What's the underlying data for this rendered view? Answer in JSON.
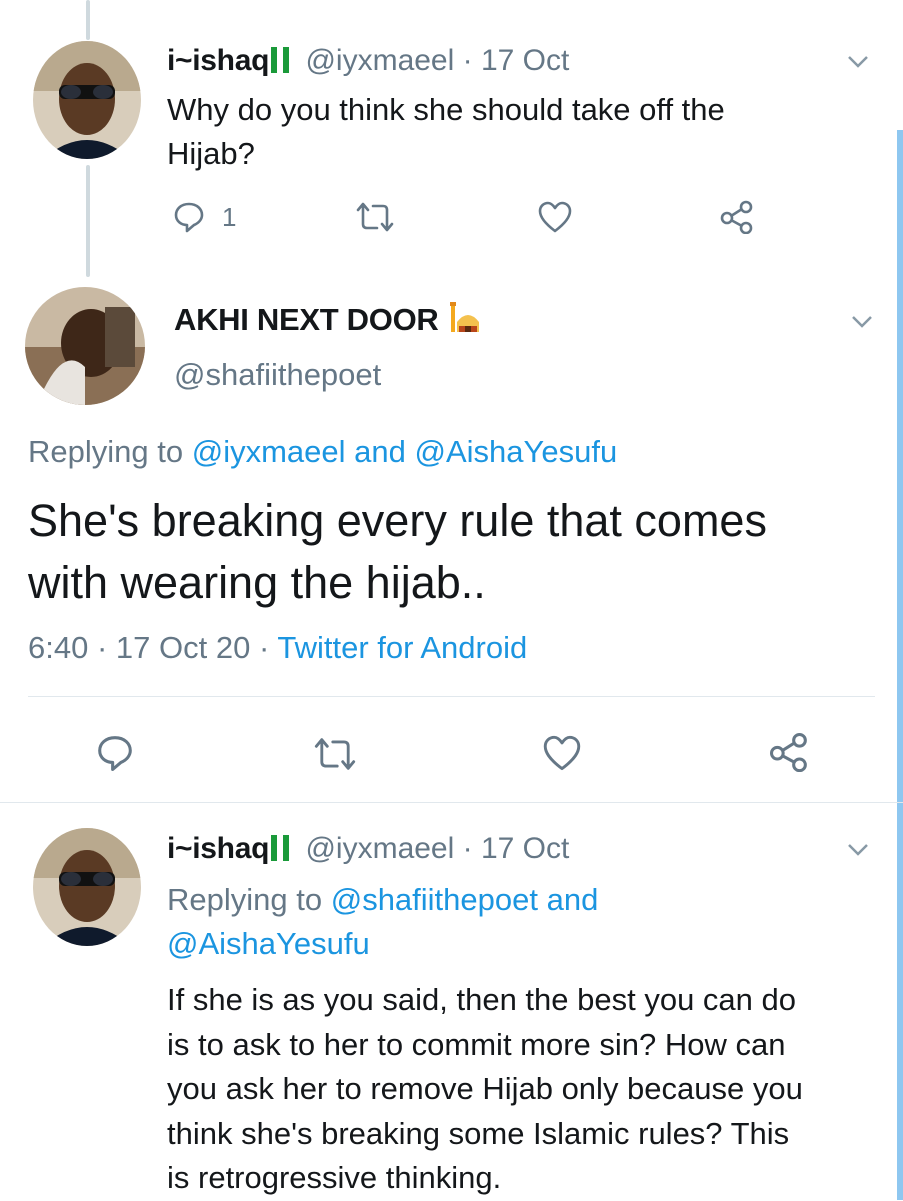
{
  "tweet1": {
    "display_name": "i~ishaq",
    "handle": "@iyxmaeel",
    "separator": "·",
    "date": "17 Oct",
    "text_line1": "Why do you think she should take off the",
    "text_line2": "Hijab?",
    "reply_count": "1"
  },
  "tweet2": {
    "display_name": "AKHI NEXT DOOR",
    "handle": "@shafiithepoet",
    "replying_prefix": "Replying to",
    "replying_user1": "@iyxmaeel",
    "replying_and": "and",
    "replying_user2": "@AishaYesufu",
    "text_line1": "She's breaking every rule that comes",
    "text_line2": "with wearing the hijab..",
    "time": "6:40",
    "separator": "·",
    "date": "17 Oct 20",
    "source": "Twitter for Android"
  },
  "tweet3": {
    "display_name": "i~ishaq",
    "handle": "@iyxmaeel",
    "separator": "·",
    "date": "17 Oct",
    "replying_prefix": "Replying to",
    "replying_user1": "@shafiithepoet",
    "replying_and": "and",
    "replying_user2": "@AishaYesufu",
    "text_lines": [
      "If she is as you said, then the best you can do",
      "is to ask to her to commit more sin? How can",
      "you ask her to remove Hijab only because you",
      "think she's breaking some Islamic rules? This",
      "is retrogressive thinking."
    ]
  },
  "icons": {
    "reply": "reply-icon",
    "retweet": "retweet-icon",
    "like": "heart-icon",
    "share": "share-icon",
    "more": "chevron-down-icon",
    "flag": "nigeria-flag-icon",
    "mosque": "mosque-icon"
  },
  "colors": {
    "link": "#1b95e0",
    "muted": "#657786",
    "divider": "#e1e8ed",
    "thread_line": "#cfd9de",
    "scrollbar": "#8ec7f0"
  }
}
